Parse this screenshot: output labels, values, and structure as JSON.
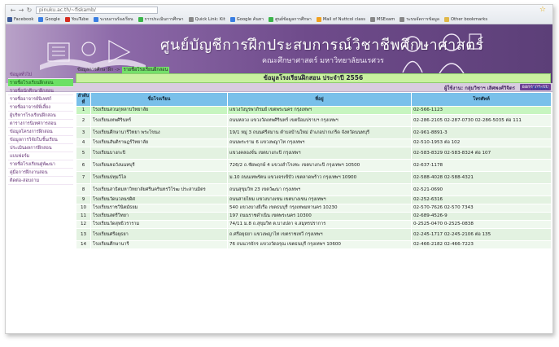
{
  "browser": {
    "url": "pinuku.ac.th/~fiskamb/",
    "bookmarks": [
      {
        "label": "Facebook",
        "color": "#3b5998"
      },
      {
        "label": "Google",
        "color": "#3a7ee2"
      },
      {
        "label": "YouTube",
        "color": "#d62d20"
      },
      {
        "label": "ระบบงานร้องเรียน",
        "color": "#3a7ee2"
      },
      {
        "label": "การประเมินการศึกษา",
        "color": "#3bb54a"
      },
      {
        "label": "Quick Link: Kit",
        "color": "#888888"
      },
      {
        "label": "Google ค้นหา",
        "color": "#3a7ee2"
      },
      {
        "label": "ศูนย์ข้อมูลการศึกษา",
        "color": "#3bb54a"
      },
      {
        "label": "Mail of Nuttcol class",
        "color": "#f0a020"
      },
      {
        "label": "MSExam",
        "color": "#888888"
      },
      {
        "label": "ระบบจัดการข้อมูล",
        "color": "#888888"
      },
      {
        "label": "Other bookmarks",
        "color": "#e0b84a"
      }
    ]
  },
  "banner": {
    "title": "ศูนย์บัญชีการฝึกประสบการณ์วิชาชีพศึกษาศาสตร์",
    "subtitle": "คณะศึกษาศาสตร์ มหาวิทยาลัยนเรศวร"
  },
  "userbar": {
    "user": "ผู้ใช้งาน: กลุ่มวิชาฯ เลิศพงศ์วิจิตร",
    "logout": "ออกจากระบบ"
  },
  "menu": {
    "tabs": [
      "ข้อมูลการศึกษาฝึก",
      "กิจกรรมการฝึกงาน",
      "โครงการฝึกสอน",
      "การวิจัย",
      "บันทึกข้อมูล"
    ]
  },
  "breadcrumb": {
    "parent": "ข้อมูลการศึกษาฝึก ->",
    "current": "รายชื่อโรงเรียนฝึกสอน"
  },
  "sidebar": {
    "items": [
      "ข้อมูลทั่วไป",
      "รายชื่อโรงเรียนฝึกสอน",
      "รายชื่อนักศึกษาฝึกสอน",
      "รายชื่ออาจารย์นิเทศก์",
      "รายชื่ออาจารย์พี่เลี้ยง",
      "ผู้บริหารโรงเรียนฝึกสอน",
      "ตารางการนิเทศการสอน",
      "ข้อมูลโครงการฝึกสอน",
      "ข้อมูลการวิจัยในชั้นเรียน",
      "ประเมินผลการฝึกสอน",
      "แบบฟอร์ม",
      "รายชื่อโรงเรียนคู่พัฒนา",
      "คู่มือการฝึกงานสอน",
      "ติดต่อ-สอบถาม"
    ]
  },
  "content": {
    "title": "ข้อมูลโรงเรียนฝึกสอน ประจำปี 2556",
    "all_link": "[ทั้งหมด]",
    "headers": [
      "ลำดับที่",
      "ชื่อโรงเรียน",
      "ที่อยู่",
      "โทรศัพท์"
    ],
    "rows": [
      [
        "1",
        "โรงเรียนสวนกุหลาบวิทยาลัย",
        "แขวงวังบูรพาภิรมย์ เขตพระนคร กรุงเทพฯ",
        "02-566-1123"
      ],
      [
        "2",
        "โรงเรียนเทพศิรินทร์",
        "ถนนหลวง แขวงวัดเทพศิรินทร์ เขตป้อมปราบฯ กรุงเทพฯ",
        "02-286-2105 02-287-0730 02-286-5035 ต่อ 111"
      ],
      [
        "3",
        "โรงเรียนศึกษานารีวิทยา พระโขนง",
        "19/1 หมู่ 3 ถนนศรีสมาน ตำบลบ้านใหม่ อำเภอปากเกร็ด จังหวัดนนทบุรี",
        "02-961-8891-3"
      ],
      [
        "4",
        "โรงเรียนสันติราษฎร์วิทยาลัย",
        "ถนนพระราม 6 แขวงพญาไท กรุงเทพฯ",
        "02-510-1953 ต่อ 102"
      ],
      [
        "5",
        "โรงเรียนบางกะปิ",
        "แขวงคลองจั่น เขตบางกะปิ กรุงเทพฯ",
        "02-583-8329 02-583-8324 ต่อ 107"
      ],
      [
        "6",
        "โรงเรียนหอวังนนทบุรี",
        "726/2 ถ.ชัยพฤกษ์ 4 แขวงลำโรงชะ เขตบางกะปิ กรุงเทพฯ 10500",
        "02-637-1178"
      ],
      [
        "7",
        "โรงเรียนปทุมวิไล",
        "ม.10 ถนนเทพรัตน แขวงจรเข้บัว เขตลาดพร้าว กรุงเทพฯ 10900",
        "02-588-4028 02-588-4321"
      ],
      [
        "8",
        "โรงเรียนสาธิตมหาวิทยาลัยศรีนครินทรวิโรฒ ประสานมิตร",
        "ถนนสุขุมวิท 23 เขตวัฒนา กรุงเทพฯ",
        "02-521-0690"
      ],
      [
        "9",
        "โรงเรียนวัดนวลนรดิศ",
        "ถนนสายไหม แขวงบางเขน เขตบางเขน กรุงเทพฯ",
        "02-252-6316"
      ],
      [
        "10",
        "โรงเรียนราชวินิตมัธยม",
        "540 แขวงบางยี่เรือ เขตธนบุรี กรุงเทพมหานคร 10230",
        "02-570-7626 02-570 7343"
      ],
      [
        "11",
        "โรงเรียนสตรีวิทยา",
        "197 ถนนราชดำเนิน เขตพระนคร 10300",
        "02-689-4526-9"
      ],
      [
        "12",
        "โรงเรียนวัดสุทธิวราราม",
        "74/11 ม.8 ถ.สุขุมวิท ต.บางปลา จ.สมุทรปราการ",
        "0-2525-0470 0-2525-0838"
      ],
      [
        "13",
        "โรงเรียนศรีอยุธยา",
        "ถ.ศรีอยุธยา แขวงพญาไท เขตราชเทวี กรุงเทพฯ",
        "02-245-1717 02-245-2106 ต่อ 135"
      ],
      [
        "14",
        "โรงเรียนศึกษานารี",
        "76 ถนนวรจักร แขวงวัดอรุณ เขตธนบุรี กรุงเทพฯ 10600",
        "02-466-2182 02-466-7223"
      ]
    ]
  }
}
